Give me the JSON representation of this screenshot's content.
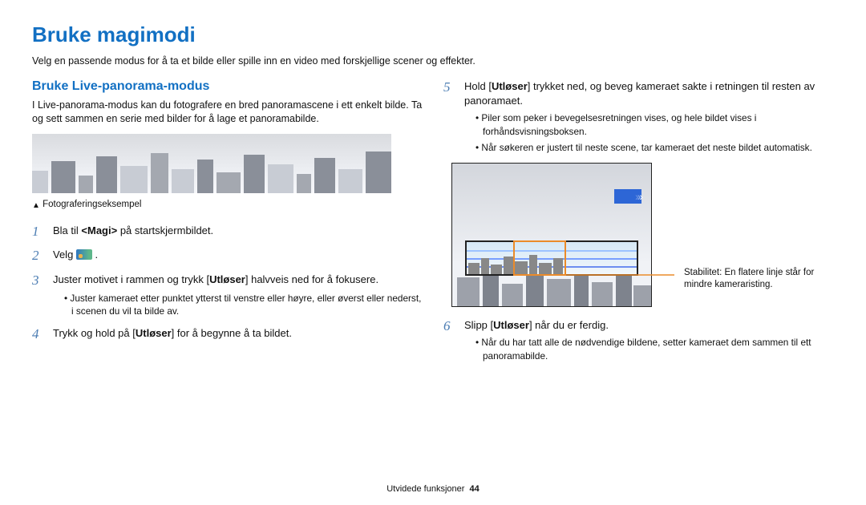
{
  "page_title": "Bruke magimodi",
  "intro": "Velg en passende modus for å ta et bilde eller spille inn en video med forskjellige scener og effekter.",
  "left": {
    "section_title": "Bruke Live-panorama-modus",
    "section_body": "I Live-panorama-modus kan du fotografere en bred panoramascene i ett enkelt bilde. Ta og sett sammen en serie med bilder for å lage et panoramabilde.",
    "caption": "Fotograferingseksempel",
    "steps": {
      "s1_pre": "Bla til ",
      "s1_tag": "<Magi>",
      "s1_post": " på startskjermbildet.",
      "s2": "Velg ",
      "s3_pre": "Juster motivet i rammen og trykk [",
      "s3_b": "Utløser",
      "s3_post": "] halvveis ned for å fokusere.",
      "s3_bullet": "Juster kameraet etter punktet ytterst til venstre eller høyre, eller øverst eller nederst, i scenen du vil ta bilde av.",
      "s4_pre": "Trykk og hold på [",
      "s4_b": "Utløser",
      "s4_post": "] for å begynne å ta bildet."
    }
  },
  "right": {
    "s5_pre": "Hold [",
    "s5_b": "Utløser",
    "s5_post": "] trykket ned, og beveg kameraet sakte i retningen til resten av panoramaet.",
    "s5_bullets": [
      "Piler som peker i bevegelsesretningen vises, og hele bildet vises i forhåndsvisningsboksen.",
      "Når søkeren er justert til neste scene, tar kameraet det neste bildet automatisk."
    ],
    "callout": "Stabilitet: En flatere linje står for mindre kameraristing.",
    "s6_pre": "Slipp [",
    "s6_b": "Utløser",
    "s6_post": "] når du er ferdig.",
    "s6_bullet": "Når du har tatt alle de nødvendige bildene, setter kameraet dem sammen til ett panoramabilde."
  },
  "footer_section": "Utvidede funksjoner",
  "page_number": "44"
}
